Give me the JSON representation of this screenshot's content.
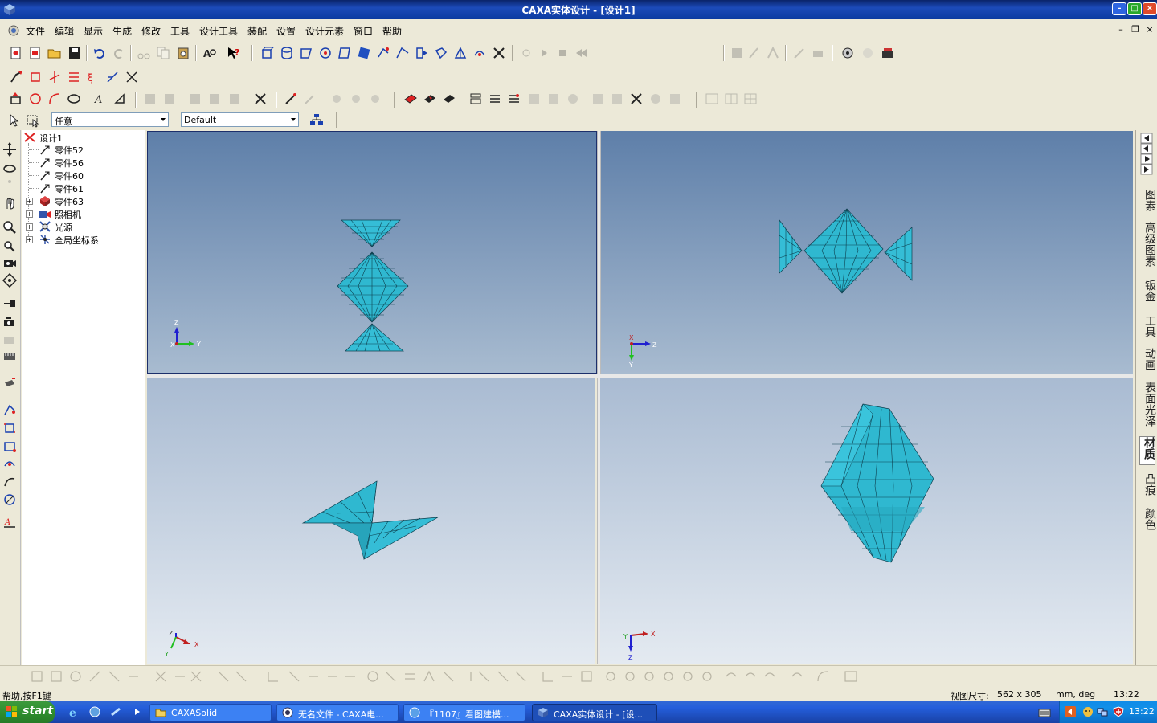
{
  "window": {
    "title": "CAXA实体设计 - [设计1]",
    "minimize": "–",
    "maximize": "□",
    "close": "×"
  },
  "menu": {
    "items": [
      "文件",
      "编辑",
      "显示",
      "生成",
      "修改",
      "工具",
      "设计工具",
      "装配",
      "设置",
      "设计元素",
      "窗口",
      "帮助"
    ],
    "mdi_minimize": "–",
    "mdi_restore": "❐",
    "mdi_close": "×"
  },
  "selectors": {
    "filter_value": "任意",
    "style_value": "Default",
    "progress_field": "'                                   '"
  },
  "tree": {
    "root": "设计1",
    "items": [
      {
        "label": "零件52",
        "expandable": false
      },
      {
        "label": "零件56",
        "expandable": false
      },
      {
        "label": "零件60",
        "expandable": false
      },
      {
        "label": "零件61",
        "expandable": false
      },
      {
        "label": "零件63",
        "expandable": true
      },
      {
        "label": "照相机",
        "expandable": true
      },
      {
        "label": "光源",
        "expandable": true
      },
      {
        "label": "全局坐标系",
        "expandable": true
      }
    ]
  },
  "viewports": {
    "top_left_axes": {
      "a": "Z",
      "b": "X",
      "c": "Y"
    },
    "top_right_axes": {
      "a": "X",
      "b": "Z",
      "c": "Y"
    },
    "bottom_left_axes": {
      "a": "Z",
      "b": "X",
      "c": "Y"
    },
    "bottom_right_axes": {
      "a": "Y",
      "b": "X",
      "c": "Z"
    }
  },
  "right_tabs": [
    "图素",
    "高级图素",
    "钣金",
    "工具",
    "动画",
    "表面光泽",
    "材质",
    "凸痕",
    "颜色"
  ],
  "right_tabs_active": "材质",
  "status": {
    "help": "帮助,按F1键",
    "view_size_label": "视图尺寸:",
    "view_size_value": "562 x 305",
    "units": "mm, deg",
    "time": "13:22"
  },
  "taskbar": {
    "start": "start",
    "tasks": [
      {
        "label": "CAXASolid",
        "active": false
      },
      {
        "label": "无名文件 - CAXA电...",
        "active": false
      },
      {
        "label": "『1107』看图建模...",
        "active": false
      },
      {
        "label": "CAXA实体设计 - [设...",
        "active": true
      }
    ],
    "clock": "13:22"
  },
  "colors": {
    "model": "#2fb8d0",
    "model_edge": "#0d3f4e",
    "title_bar": "#0b3ba0",
    "viewport_top": "#5e7fa9",
    "viewport_bottom": "#e4eaf1"
  },
  "icons": {
    "toolbar1": [
      "new-design-icon",
      "new-drawing-icon",
      "open-icon",
      "save-icon",
      "undo-icon",
      "redo-icon",
      "cut-icon",
      "copy-icon",
      "paste-icon",
      "find-icon",
      "help-icon",
      "box-icon",
      "cylinder-icon",
      "cone-icon",
      "sphere-icon",
      "torus-icon",
      "extrude-icon",
      "revolve-icon",
      "sweep-icon",
      "loft-icon",
      "shell-icon",
      "blend-icon",
      "chamfer-icon",
      "draft-icon",
      "cut-solid-icon"
    ],
    "toolbar_left": [
      "move-icon",
      "rotate-icon",
      "pan-icon",
      "zoom-icon",
      "zoom-window-icon",
      "camera-icon",
      "light-icon",
      "measure-icon",
      "section-icon"
    ]
  }
}
